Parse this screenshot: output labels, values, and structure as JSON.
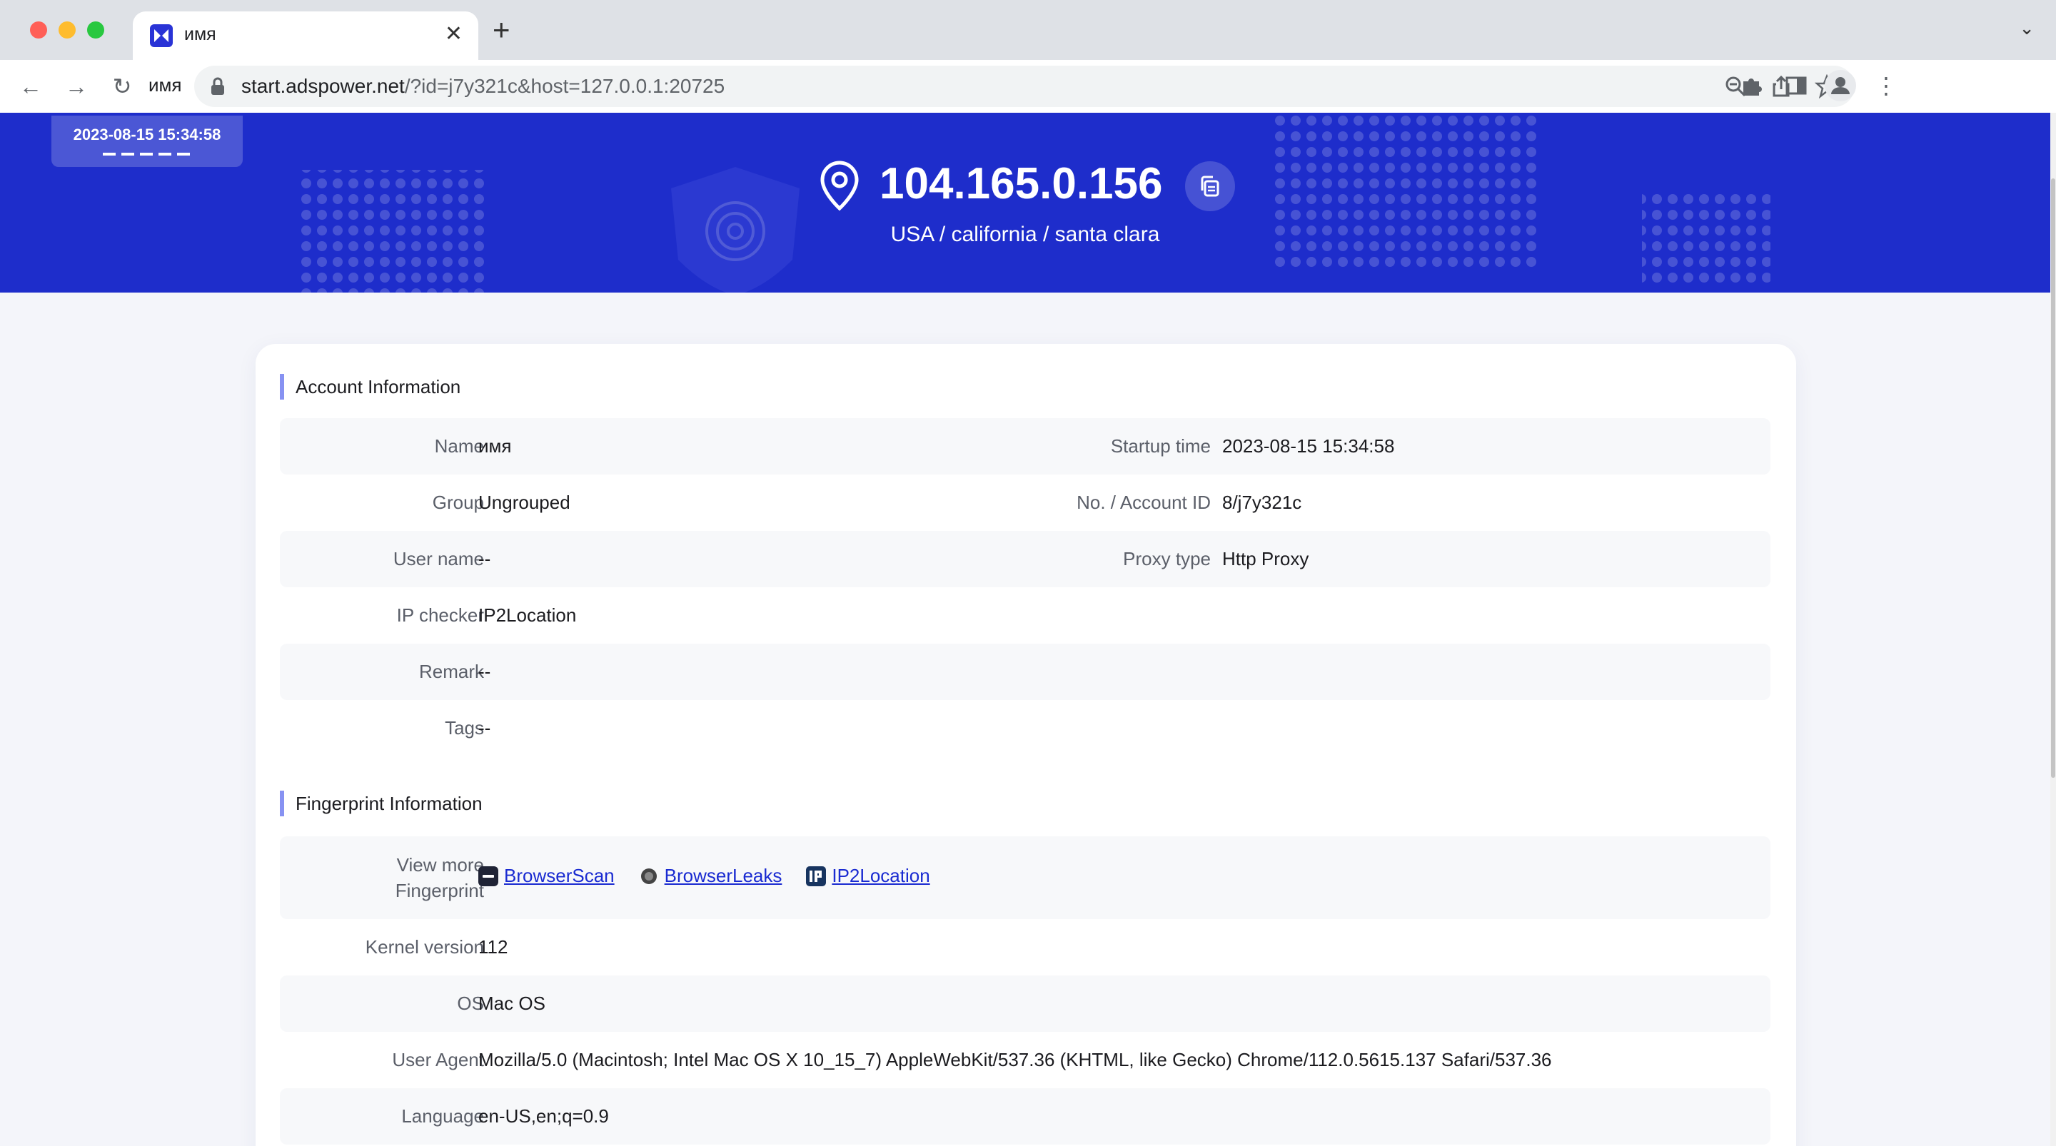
{
  "browser": {
    "tab_title": "имя",
    "profile_label": "имя",
    "url_host": "start.adspower.net",
    "url_rest": "/?id=j7y321c&host=127.0.0.1:20725"
  },
  "hero": {
    "time": "2023-08-15 15:34:58",
    "ip": "104.165.0.156",
    "location": "USA / california / santa clara"
  },
  "account": {
    "title": "Account Information",
    "rows": [
      {
        "label": "Name",
        "value": "имя",
        "label2": "Startup time",
        "value2": "2023-08-15 15:34:58"
      },
      {
        "label": "Group",
        "value": "Ungrouped",
        "label2": "No. / Account ID",
        "value2": "8/j7y321c"
      },
      {
        "label": "User name",
        "value": "--",
        "label2": "Proxy type",
        "value2": "Http Proxy"
      },
      {
        "label": "IP checker",
        "value": "IP2Location"
      },
      {
        "label": "Remark",
        "value": "--"
      },
      {
        "label": "Tags",
        "value": "--"
      }
    ]
  },
  "fingerprint": {
    "title": "Fingerprint Information",
    "view_more_label_1": "View more",
    "view_more_label_2": "Fingerprint",
    "links": [
      "BrowserScan",
      "BrowserLeaks",
      "IP2Location"
    ],
    "rows": [
      {
        "label": "Kernel version",
        "value": "112"
      },
      {
        "label": "OS",
        "value": "Mac OS"
      },
      {
        "label": "User Agent",
        "value": "Mozilla/5.0 (Macintosh; Intel Mac OS X 10_15_7) AppleWebKit/537.36 (KHTML, like Gecko) Chrome/112.0.5615.137 Safari/537.36"
      },
      {
        "label": "Language",
        "value": "en-US,en;q=0.9"
      }
    ]
  },
  "colors": {
    "brand": "#1e2dcb",
    "accent_bar": "#8792f2",
    "link": "#1a2bd1"
  }
}
